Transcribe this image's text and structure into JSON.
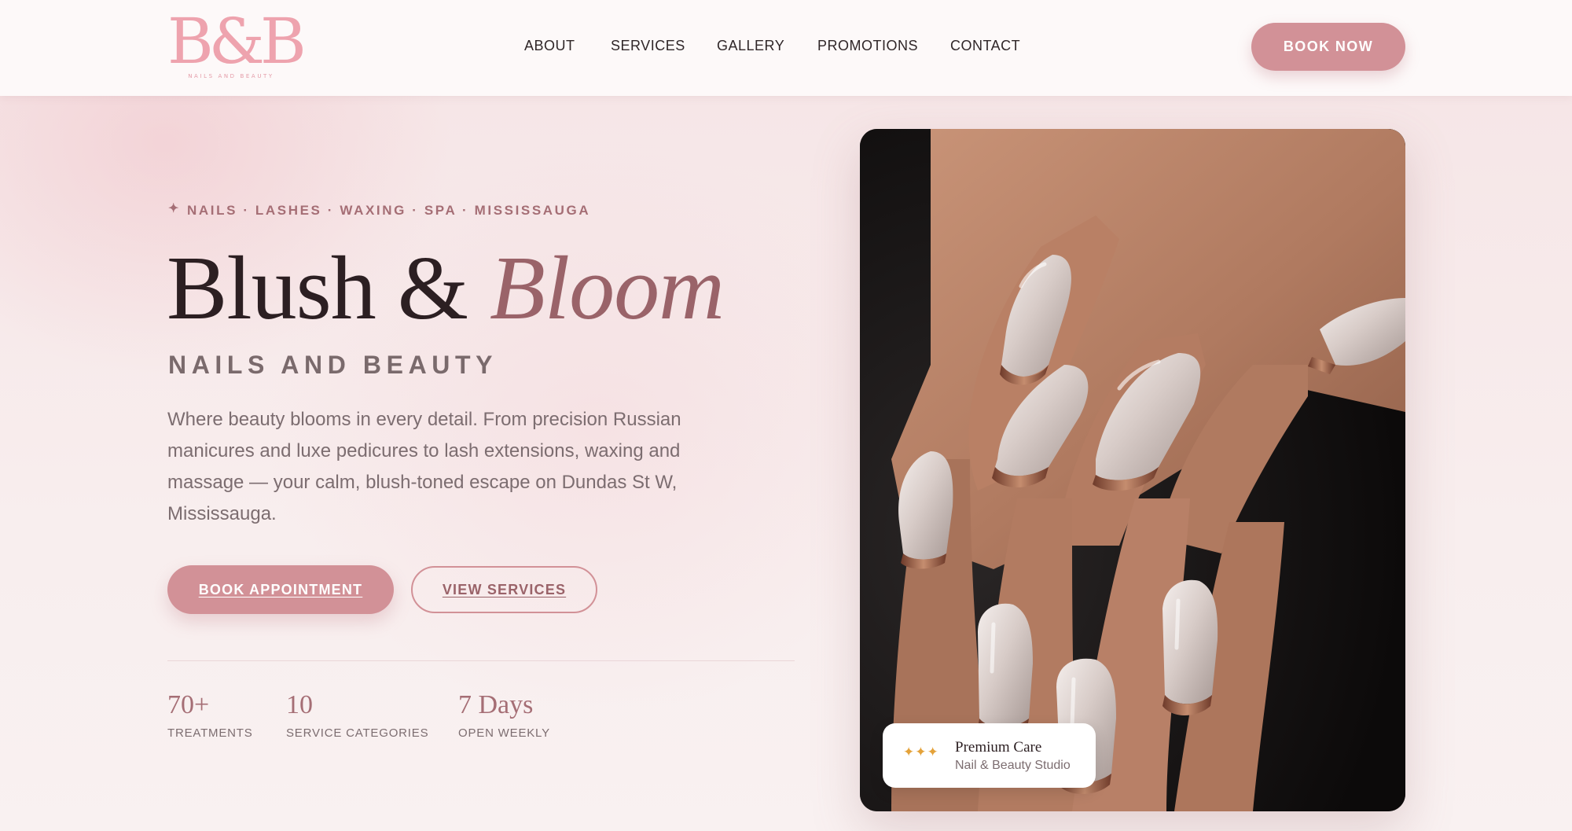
{
  "brand": {
    "logo_mark": "B&B",
    "logo_tagline": "NAILS AND BEAUTY",
    "color_primary": "#d29197",
    "color_logo": "#eea3ae",
    "color_accent_text": "#9a6369"
  },
  "nav": {
    "items": [
      "ABOUT",
      "SERVICES",
      "GALLERY",
      "PROMOTIONS",
      "CONTACT"
    ],
    "cta_label": "BOOK NOW"
  },
  "hero": {
    "eyebrow_icon": "sparkle-icon",
    "eyebrow": "NAILS · LASHES · WAXING · SPA · MISSISSAUGA",
    "title_main": "Blush &",
    "title_accent": "Bloom",
    "subtitle": "NAILS AND BEAUTY",
    "description": "Where beauty blooms in every detail. From precision Russian manicures and luxe pedicures to lash extensions, waxing and massage — your calm, blush-toned escape on Dundas St W, Mississauga.",
    "primary_button": "BOOK APPOINTMENT",
    "secondary_button": "VIEW SERVICES"
  },
  "stats": [
    {
      "value": "70+",
      "label": "TREATMENTS"
    },
    {
      "value": "10",
      "label": "SERVICE CATEGORIES"
    },
    {
      "value": "7 Days",
      "label": "OPEN WEEKLY"
    }
  ],
  "badge": {
    "icon": "stars-icon",
    "stars": "✦✦✦",
    "title": "Premium Care",
    "subtitle": "Nail & Beauty Studio"
  }
}
